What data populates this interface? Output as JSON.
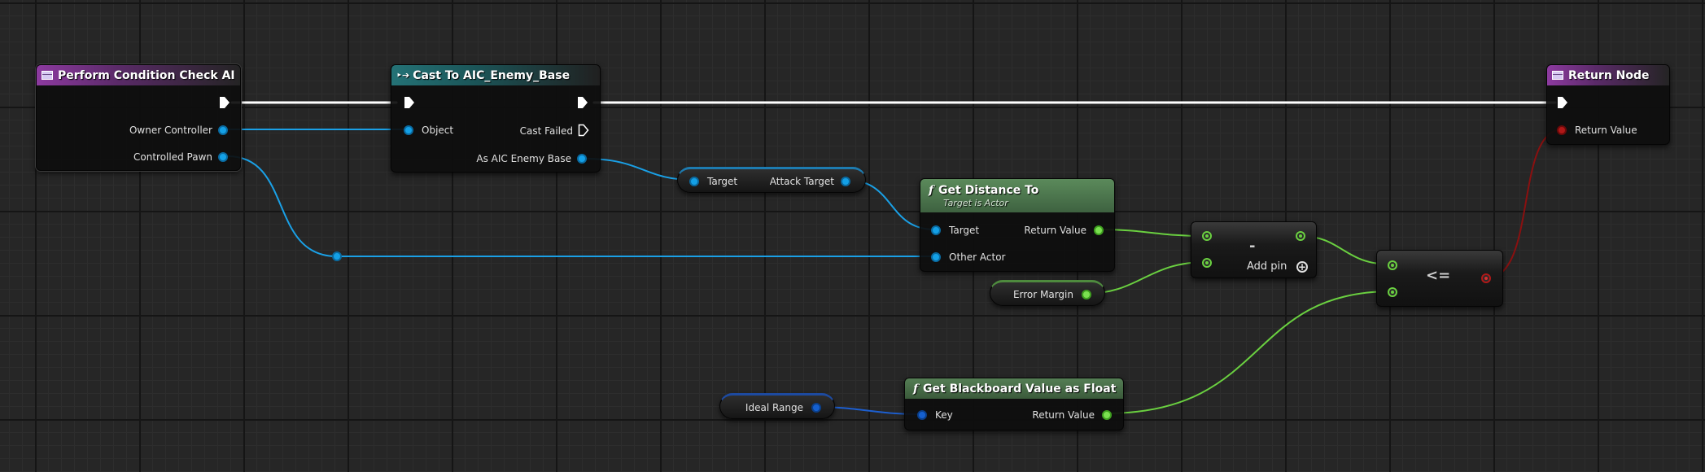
{
  "graph": {
    "entry_node": {
      "title": "Perform Condition Check AI",
      "pins": {
        "owner_controller": "Owner Controller",
        "controlled_pawn": "Controlled Pawn"
      }
    },
    "cast_node": {
      "title": "Cast To AIC_Enemy_Base",
      "pins": {
        "object": "Object",
        "cast_failed": "Cast Failed",
        "as_aic_enemy_base": "As AIC Enemy Base"
      }
    },
    "attack_target_node": {
      "pins": {
        "target": "Target",
        "attack_target": "Attack Target"
      }
    },
    "get_distance_node": {
      "title": "Get Distance To",
      "subtitle": "Target is Actor",
      "pins": {
        "target": "Target",
        "other_actor": "Other Actor",
        "return_value": "Return Value"
      }
    },
    "subtract_node": {
      "operator": "-",
      "add_pin": "Add pin"
    },
    "error_margin_var": {
      "label": "Error Margin"
    },
    "compare_node": {
      "operator": "<="
    },
    "return_node": {
      "title": "Return Node",
      "pins": {
        "return_value": "Return Value"
      }
    },
    "ideal_range_var": {
      "label": "Ideal Range"
    },
    "blackboard_node": {
      "title": "Get Blackboard Value as Float",
      "pins": {
        "key": "Key",
        "return_value": "Return Value"
      }
    }
  },
  "colors": {
    "exec_wire": "#ffffff",
    "object_wire": "#1aa0e6",
    "float_wire": "#6ad040",
    "bool_wire": "#b01818",
    "key_wire": "#1d5fd0"
  },
  "icons": [
    "function-icon",
    "cast-icon",
    "exec-pin-icon",
    "add-pin-icon",
    "entry-node-icon",
    "return-node-icon"
  ]
}
